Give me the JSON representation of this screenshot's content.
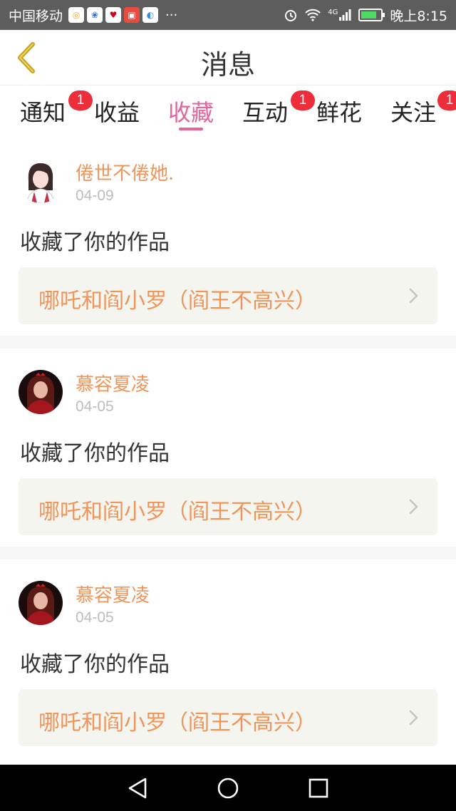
{
  "status_bar": {
    "carrier": "中国移动",
    "app_icons": [
      {
        "name": "weibo-app-icon",
        "color": "#f5a623",
        "glyph": "◎"
      },
      {
        "name": "baidu-app-icon",
        "color": "#2b6de5",
        "glyph": "❀"
      },
      {
        "name": "red-app-icon",
        "color": "#d0021b",
        "glyph": "♥"
      },
      {
        "name": "shop-app-icon",
        "color": "#e94b3c",
        "glyph": "▣"
      },
      {
        "name": "browser-app-icon",
        "color": "#2d8cf0",
        "glyph": "◐"
      }
    ],
    "more": "···",
    "network": "4G",
    "time": "晚上8:15",
    "battery_level": 0.8
  },
  "header": {
    "title": "消息",
    "back_icon": "back-chevron-icon",
    "accent_color": "#c8a21a"
  },
  "tabs": [
    {
      "label": "通知",
      "badge": "1",
      "active": false
    },
    {
      "label": "收益",
      "badge": null,
      "active": false
    },
    {
      "label": "收藏",
      "badge": null,
      "active": true
    },
    {
      "label": "互动",
      "badge": "1",
      "active": false
    },
    {
      "label": "鲜花",
      "badge": null,
      "active": false
    },
    {
      "label": "关注",
      "badge": "1",
      "active": false
    }
  ],
  "items": [
    {
      "user": "倦世不倦她.",
      "date": "04-09",
      "action": "收藏了你的作品",
      "work": "哪吒和阎小罗（阎王不高兴）",
      "avatar": "girl-avatar-light"
    },
    {
      "user": "慕容夏凌",
      "date": "04-05",
      "action": "收藏了你的作品",
      "work": "哪吒和阎小罗（阎王不高兴）",
      "avatar": "girl-avatar-dark"
    },
    {
      "user": "慕容夏凌",
      "date": "04-05",
      "action": "收藏了你的作品",
      "work": "哪吒和阎小罗（阎王不高兴）",
      "avatar": "girl-avatar-dark"
    }
  ],
  "colors": {
    "accent_pink": "#e4649b",
    "name_orange": "#f0945a",
    "badge_red": "#ee2d3a"
  }
}
